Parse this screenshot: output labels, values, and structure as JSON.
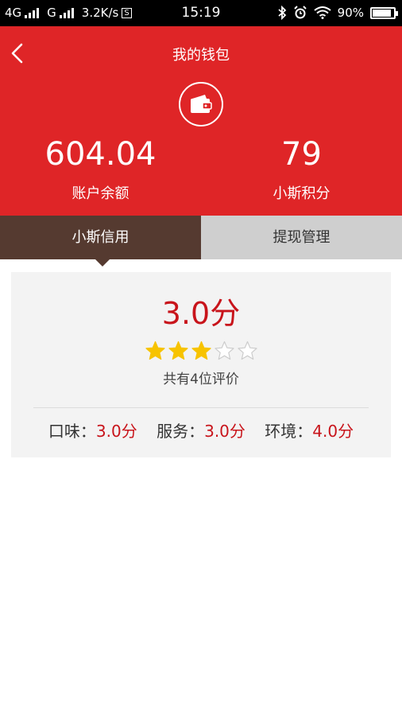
{
  "status_bar": {
    "network1": "4G",
    "network2": "G",
    "speed": "3.2K/s",
    "time": "15:19",
    "battery": "90%",
    "battery_level": 0.9
  },
  "header": {
    "title": "我的钱包",
    "balance": {
      "value": "604.04",
      "label": "账户余额"
    },
    "points": {
      "value": "79",
      "label": "小斯积分"
    }
  },
  "tabs": [
    {
      "label": "小斯信用",
      "active": true
    },
    {
      "label": "提现管理",
      "active": false
    }
  ],
  "credit": {
    "score": "3.0分",
    "rating": 3,
    "max_rating": 5,
    "review_count": "共有4位评价",
    "subscores": [
      {
        "label": "口味：",
        "value": "3.0分"
      },
      {
        "label": "服务：",
        "value": "3.0分"
      },
      {
        "label": "环境：",
        "value": "4.0分"
      }
    ]
  },
  "colors": {
    "header_red": "#df2527",
    "tab_active": "#553a30",
    "tab_inactive": "#cfcfcf",
    "accent_red": "#c8141b",
    "star_gold": "#f7c300"
  }
}
